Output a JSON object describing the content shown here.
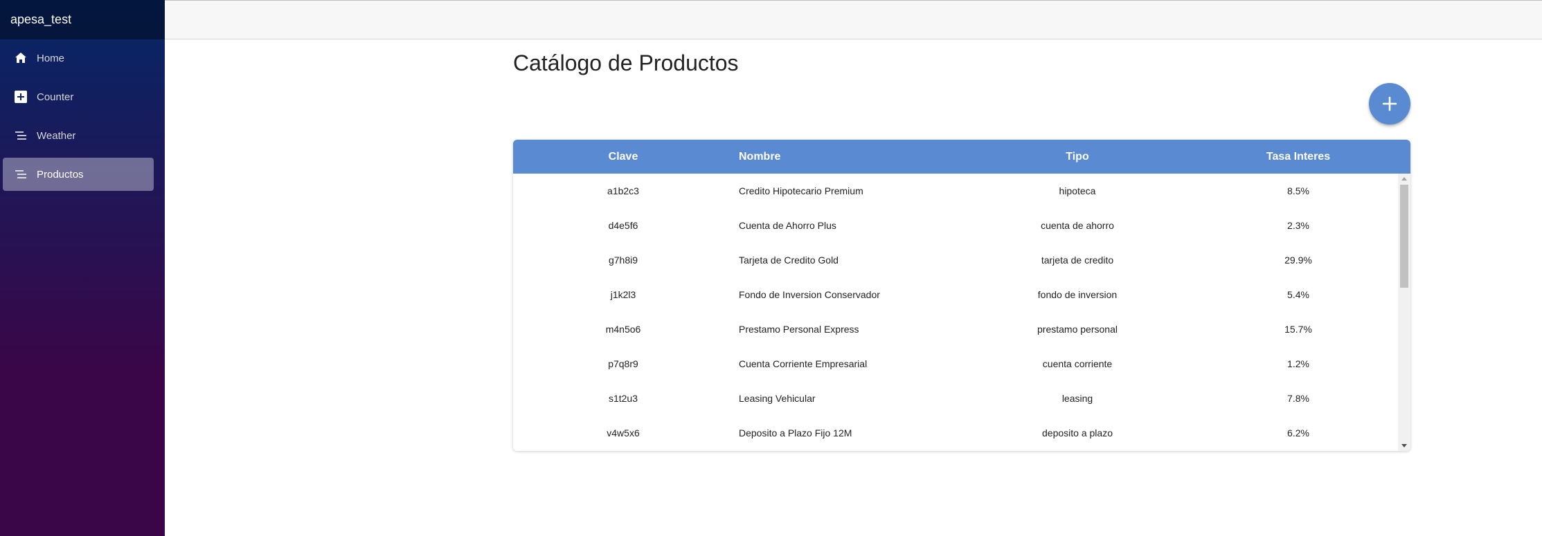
{
  "app": {
    "brand": "apesa_test"
  },
  "sidebar": {
    "items": [
      {
        "label": "Home",
        "icon": "home-icon",
        "active": false
      },
      {
        "label": "Counter",
        "icon": "plus-square-icon",
        "active": false
      },
      {
        "label": "Weather",
        "icon": "list-icon",
        "active": false
      },
      {
        "label": "Productos",
        "icon": "list-icon",
        "active": true
      }
    ]
  },
  "main": {
    "title": "Catálogo de Productos",
    "add_button_icon": "plus-icon"
  },
  "table": {
    "columns": [
      "Clave",
      "Nombre",
      "Tipo",
      "Tasa Interes"
    ],
    "rows": [
      {
        "clave": "a1b2c3",
        "nombre": "Credito Hipotecario Premium",
        "tipo": "hipoteca",
        "tasa": "8.5%"
      },
      {
        "clave": "d4e5f6",
        "nombre": "Cuenta de Ahorro Plus",
        "tipo": "cuenta de ahorro",
        "tasa": "2.3%"
      },
      {
        "clave": "g7h8i9",
        "nombre": "Tarjeta de Credito Gold",
        "tipo": "tarjeta de credito",
        "tasa": "29.9%"
      },
      {
        "clave": "j1k2l3",
        "nombre": "Fondo de Inversion Conservador",
        "tipo": "fondo de inversion",
        "tasa": "5.4%"
      },
      {
        "clave": "m4n5o6",
        "nombre": "Prestamo Personal Express",
        "tipo": "prestamo personal",
        "tasa": "15.7%"
      },
      {
        "clave": "p7q8r9",
        "nombre": "Cuenta Corriente Empresarial",
        "tipo": "cuenta corriente",
        "tasa": "1.2%"
      },
      {
        "clave": "s1t2u3",
        "nombre": "Leasing Vehicular",
        "tipo": "leasing",
        "tasa": "7.8%"
      },
      {
        "clave": "v4w5x6",
        "nombre": "Deposito a Plazo Fijo 12M",
        "tipo": "deposito a plazo",
        "tasa": "6.2%"
      }
    ]
  },
  "colors": {
    "accent": "#5a8ad1",
    "sidebar_top": "#052767",
    "sidebar_bottom": "#3a0647"
  }
}
